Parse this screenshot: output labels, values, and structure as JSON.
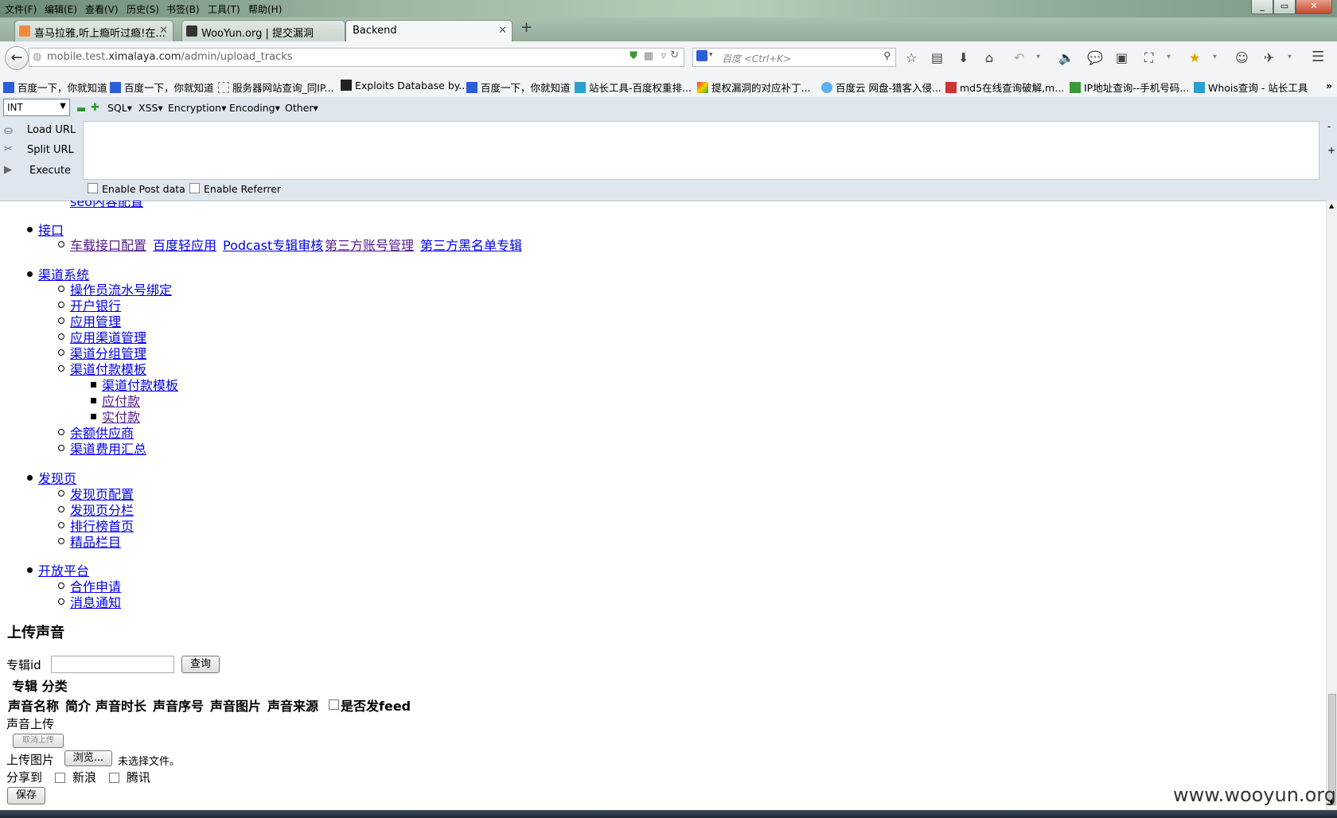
{
  "menubar": [
    "文件(F)",
    "编辑(E)",
    "查看(V)",
    "历史(S)",
    "书签(B)",
    "工具(T)",
    "帮助(H)"
  ],
  "tabs": [
    {
      "title": "喜马拉雅,听上瘾听过瘾!在...",
      "active": false
    },
    {
      "title": "WooYun.org | 提交漏洞",
      "active": false
    },
    {
      "title": "Backend",
      "active": true
    }
  ],
  "url": {
    "prefix": "mobile.test.",
    "host": "ximalaya.com",
    "path": "/admin/upload_tracks"
  },
  "search": {
    "placeholder": "百度 <Ctrl+K>"
  },
  "bookmarks": [
    "百度一下，你就知道",
    "百度一下，你就知道",
    "服务器网站查询_同IP...",
    "Exploits Database by...",
    "百度一下，你就知道",
    "站长工具-百度权重排...",
    "提权漏洞的对应补丁...",
    "百度云 网盘-猎客入侵...",
    "md5在线查询破解,m...",
    "IP地址查询--手机号码...",
    "Whois查询 - 站长工具"
  ],
  "hackbar": {
    "select": "INT",
    "menus": [
      "SQL",
      "XSS",
      "Encryption",
      "Encoding",
      "Other"
    ],
    "actions": [
      "Load URL",
      "Split URL",
      "Execute"
    ],
    "enable_post": "Enable Post data",
    "enable_referrer": "Enable Referrer"
  },
  "nav": {
    "partial_top": "seo内容配置",
    "interface": {
      "label": "接口",
      "items": [
        "车载接口配置",
        "百度轻应用",
        "Podcast专辑审核",
        "第三方账号管理",
        "第三方黑名单专辑"
      ]
    },
    "channel": {
      "label": "渠道系统",
      "items": [
        "操作员流水号绑定",
        "开户银行",
        "应用管理",
        "应用渠道管理",
        "渠道分组管理",
        "渠道付款模板"
      ],
      "sub": [
        "渠道付款模板",
        "应付款",
        "实付款"
      ],
      "items_after": [
        "余额供应商",
        "渠道费用汇总"
      ]
    },
    "discover": {
      "label": "发现页",
      "items": [
        "发现页配置",
        "发现页分栏",
        "排行榜首页",
        "精品栏目"
      ]
    },
    "open": {
      "label": "开放平台",
      "items": [
        "合作申请",
        "消息通知"
      ]
    }
  },
  "form": {
    "title": "上传声音",
    "album_id_label": "专辑id",
    "query_button": "查询",
    "album_category": "专辑 分类",
    "columns": [
      "声音名称",
      "简介",
      "声音时长",
      "声音序号",
      "声音图片",
      "声音来源"
    ],
    "send_feed": "是否发feed",
    "upload_label": "声音上传",
    "cancel_upload": "取消上传",
    "image_label": "上传图片",
    "browse": "浏览...",
    "no_file": "未选择文件。",
    "share_label": "分享到",
    "share_sina": "新浪",
    "share_tencent": "腾讯",
    "save": "保存"
  },
  "watermark": "www.wooyun.org"
}
